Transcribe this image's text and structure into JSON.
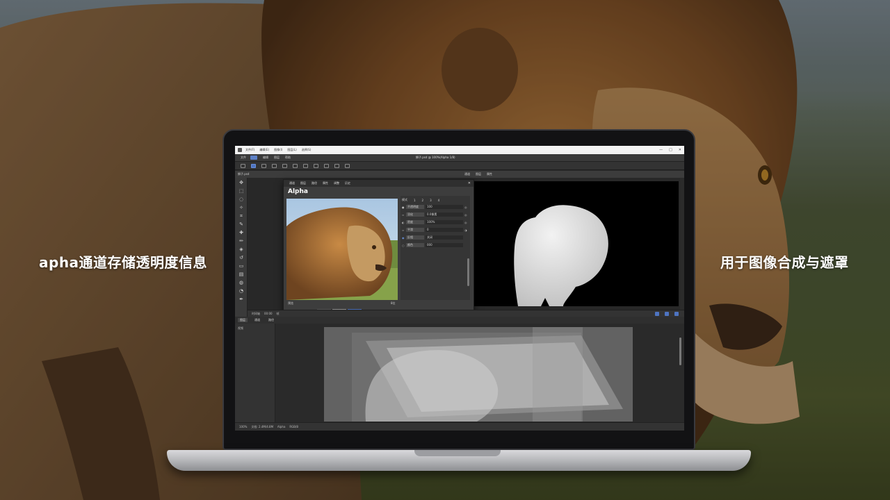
{
  "captions": {
    "left": "apha通道存储透明度信息",
    "right": "用于图像合成与遮罩"
  },
  "app": {
    "menu": [
      "文件(F)",
      "编辑(E)",
      "图像(I)",
      "图层(L)",
      "选择(S)"
    ],
    "window_controls": [
      "—",
      "□",
      "✕"
    ],
    "option_bar": [
      "文件",
      "编辑",
      "图层",
      "帮助"
    ],
    "doc_title": "狮子.psd @ 100%(Alpha 1/8)",
    "doc_tab": "狮子.psd",
    "panel_tabs": [
      "通道",
      "图层",
      "属性"
    ]
  },
  "dialog": {
    "tabs": [
      "通道",
      "图层",
      "路径",
      "属性",
      "调整",
      "历史"
    ],
    "close": "✕",
    "title": "Alpha",
    "prop_top": [
      "模式",
      "1",
      "2",
      "3",
      "4"
    ],
    "properties": [
      {
        "icon": "●",
        "name": "不透明度",
        "value": "100"
      },
      {
        "icon": "≈",
        "name": "羽化",
        "value": "0.0像素"
      },
      {
        "icon": "◐",
        "name": "密度",
        "value": "100%"
      },
      {
        "icon": "≈",
        "name": "平滑",
        "value": "0"
      },
      {
        "icon": "◉",
        "name": "反相",
        "value": "关闭"
      },
      {
        "icon": "○",
        "name": "颜色",
        "value": "000"
      }
    ],
    "footer_label": "预览",
    "footer_value": "8位"
  },
  "timeline": {
    "header": [
      "时间轴",
      "00:00",
      "帧"
    ],
    "tabs": [
      "图层",
      "通道",
      "路径"
    ],
    "left_label": "视频"
  },
  "statusbar": [
    "100%",
    "文档: 2.4M/4.8M",
    "Alpha",
    "RGB/8"
  ],
  "colors": {
    "accent": "#4e74c1",
    "mask_white": "#e6e6e6",
    "lion_mane": "#8a5a2a"
  }
}
